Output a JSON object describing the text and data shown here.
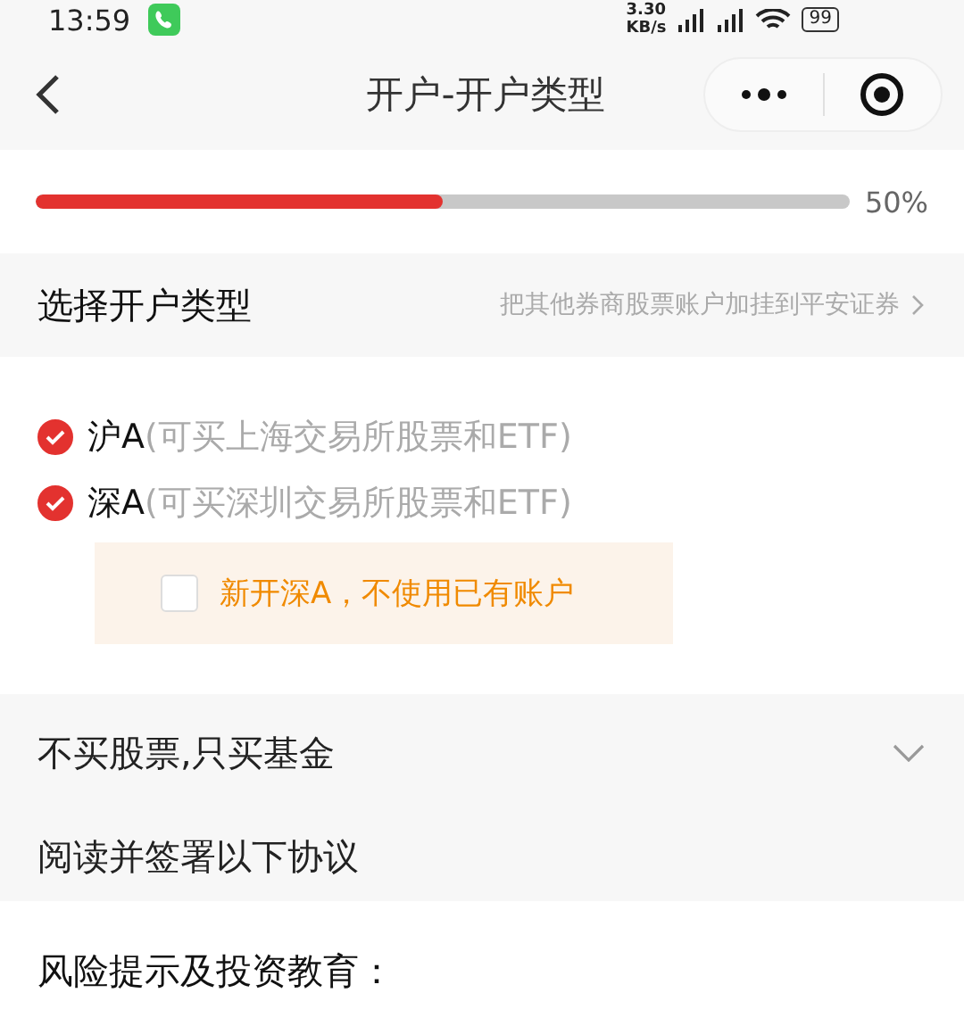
{
  "status_bar": {
    "time": "13:59",
    "net_speed": "3.30",
    "net_unit": "KB/s",
    "battery": "99"
  },
  "header": {
    "title": "开户-开户类型"
  },
  "progress": {
    "level": 0.5,
    "reading": "50%"
  },
  "section": {
    "title": "选择开户类型",
    "link": "把其他券商股票账户加挂到平安证券"
  },
  "options": [
    {
      "name": "沪A",
      "desc": "(可买上海交易所股票和ETF)",
      "checked": true
    },
    {
      "name": "深A",
      "desc": "(可买深圳交易所股票和ETF)",
      "checked": true
    }
  ],
  "sub_option": {
    "label": "新开深A，不使用已有账户",
    "checked": false
  },
  "fund_only": {
    "label": "不买股票,只买基金",
    "expanded": false
  },
  "agreements": {
    "title": "阅读并签署以下协议",
    "items": [
      "风险提示及投资教育："
    ]
  }
}
